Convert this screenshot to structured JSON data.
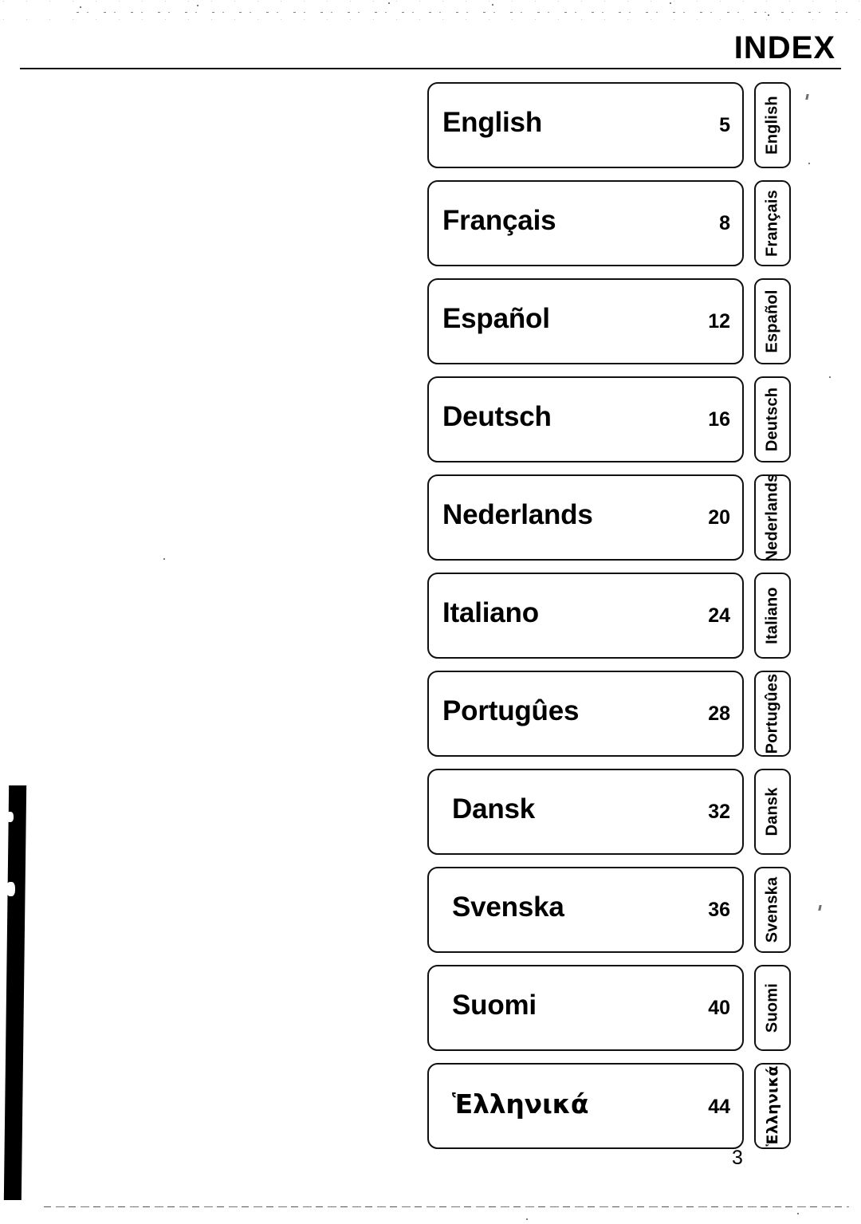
{
  "document": {
    "title": "INDEX",
    "folio": "3",
    "leader_dots": "........................................................"
  },
  "index": {
    "entries": [
      {
        "language": "English",
        "page": "5",
        "tab": "English",
        "script": "latin",
        "style": "gap-wide"
      },
      {
        "language": "Français",
        "page": "8",
        "tab": "Français",
        "script": "latin",
        "style": "gap-none"
      },
      {
        "language": "Español",
        "page": "12",
        "tab": "Español",
        "script": "latin",
        "style": "gap-none"
      },
      {
        "language": "Deutsch",
        "page": "16",
        "tab": "Deutsch",
        "script": "latin",
        "style": "gap-none"
      },
      {
        "language": "Nederlands",
        "page": "20",
        "tab": "Nederlands",
        "script": "latin",
        "style": "gap-wide"
      },
      {
        "language": "Italiano",
        "page": "24",
        "tab": "Italiano",
        "script": "latin",
        "style": "gap-wide"
      },
      {
        "language": "Portugûes",
        "page": "28",
        "tab": "Portugûes",
        "script": "latin",
        "style": "gap-wide"
      },
      {
        "language": "Dansk",
        "page": "32",
        "tab": "Dansk",
        "script": "latin",
        "style": "gap-none indent"
      },
      {
        "language": "Svenska",
        "page": "36",
        "tab": "Svenska",
        "script": "latin",
        "style": "gap-wide indent"
      },
      {
        "language": "Suomi",
        "page": "40",
        "tab": "Suomi",
        "script": "latin",
        "style": "gap-wide indent"
      },
      {
        "language": "Ἑλληνικά",
        "page": "44",
        "tab": "Ἑλληνικά",
        "script": "greek",
        "style": "gap-none indent"
      }
    ]
  },
  "colors": {
    "ink": "#000000",
    "paper": "#ffffff",
    "rule": "#111111"
  }
}
